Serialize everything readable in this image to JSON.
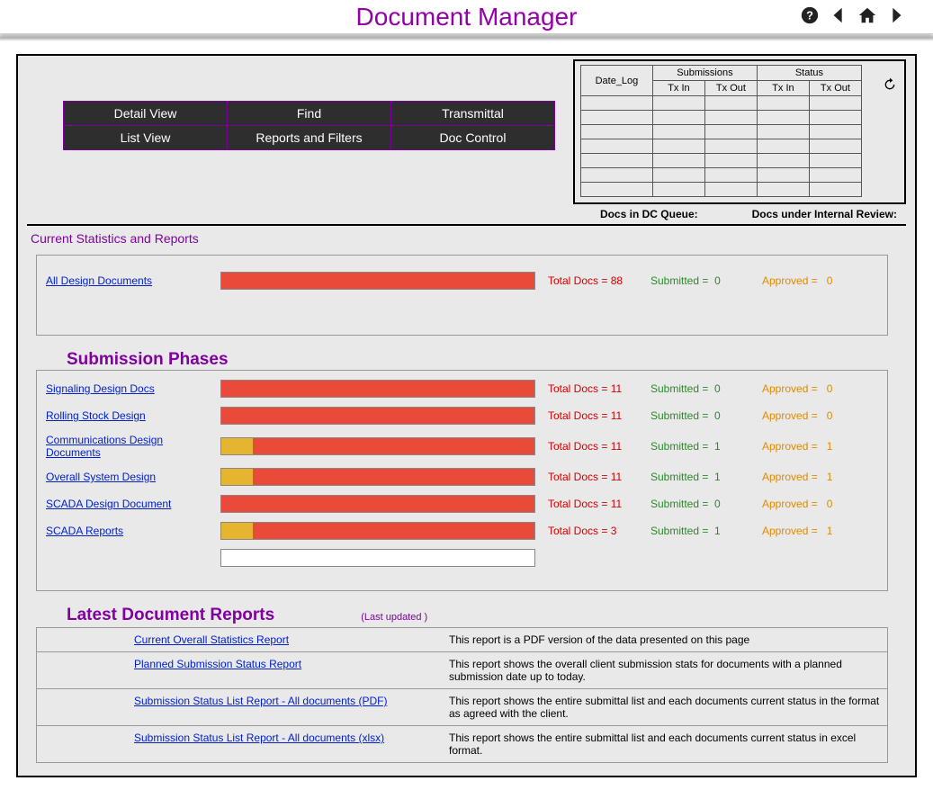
{
  "header": {
    "title": "Document Manager"
  },
  "nav": {
    "r1c1": "Detail View",
    "r1c2": "Find",
    "r1c3": "Transmittal",
    "r2c1": "List View",
    "r2c2": "Reports and Filters",
    "r2c3": "Doc Control"
  },
  "miniTable": {
    "group1": "Submissions",
    "group2": "Status",
    "dateLog": "Date_Log",
    "txIn": "Tx In",
    "txOut": "Tx Out"
  },
  "queue": {
    "dc": "Docs in DC Queue:",
    "review": "Docs under Internal Review:"
  },
  "sections": {
    "stats": "Current Statistics and Reports",
    "phases": "Submission Phases",
    "latest": "Latest Document Reports",
    "lastUpdated": "(Last updated )"
  },
  "labels": {
    "totalDocs": "Total Docs = ",
    "submitted": "Submitted = ",
    "approved": "Approved = "
  },
  "chart_data": {
    "type": "bar",
    "overall": {
      "name": "All Design Documents",
      "total": 88,
      "submitted": 0,
      "approved": 0,
      "fillPct": 100,
      "yellowPct": 0
    },
    "phases": [
      {
        "name": "Signaling Design Docs",
        "total": 11,
        "submitted": 0,
        "approved": 0,
        "fillPct": 100,
        "yellowPct": 0
      },
      {
        "name": "Rolling Stock Design",
        "total": 11,
        "submitted": 0,
        "approved": 0,
        "fillPct": 100,
        "yellowPct": 0
      },
      {
        "name": "Communications Design Documents",
        "total": 11,
        "submitted": 1,
        "approved": 1,
        "fillPct": 100,
        "yellowPct": 10
      },
      {
        "name": "Overall System Design",
        "total": 11,
        "submitted": 1,
        "approved": 1,
        "fillPct": 100,
        "yellowPct": 10
      },
      {
        "name": "SCADA Design Document",
        "total": 11,
        "submitted": 0,
        "approved": 0,
        "fillPct": 100,
        "yellowPct": 0
      },
      {
        "name": "SCADA Reports",
        "total": 3,
        "submitted": 1,
        "approved": 1,
        "fillPct": 100,
        "yellowPct": 10
      }
    ]
  },
  "reports": [
    {
      "name": "Current Overall Statistics Report",
      "desc": "This report is a PDF version of the data presented on this page"
    },
    {
      "name": "Planned Submission Status Report",
      "desc": "This report shows the overall client submission stats for documents with a planned submission date up to today."
    },
    {
      "name": "Submission Status List Report - All documents (PDF)",
      "desc": "This report shows the entire submittal list and each documents current status in the format as agreed with the client."
    },
    {
      "name": "Submission Status List Report - All documents (xlsx)",
      "desc": "This report shows the entire submittal list and each documents current status in excel format."
    }
  ]
}
